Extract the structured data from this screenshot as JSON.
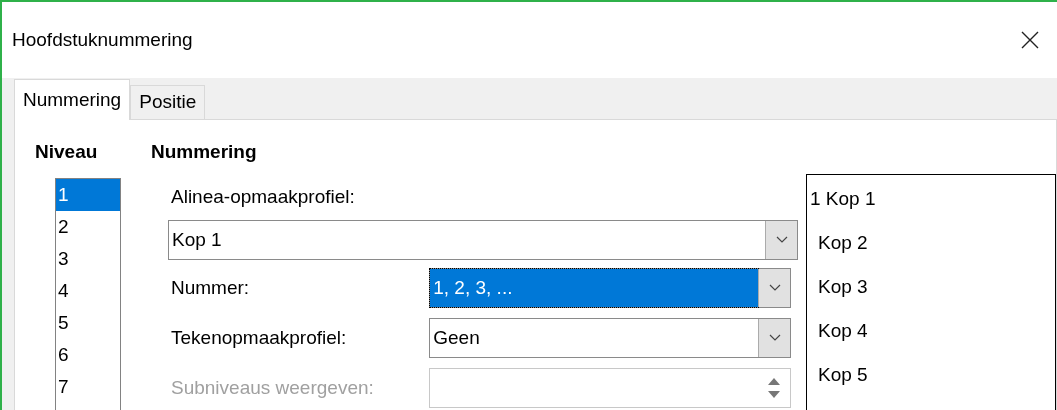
{
  "window": {
    "title": "Hoofdstuknummering"
  },
  "tabs": [
    {
      "label": "Nummering",
      "selected": true
    },
    {
      "label": "Positie",
      "selected": false
    }
  ],
  "level_list": {
    "heading": "Niveau",
    "items": [
      {
        "label": "1",
        "selected": true
      },
      {
        "label": "2",
        "selected": false
      },
      {
        "label": "3",
        "selected": false
      },
      {
        "label": "4",
        "selected": false
      },
      {
        "label": "5",
        "selected": false
      },
      {
        "label": "6",
        "selected": false
      },
      {
        "label": "7",
        "selected": false
      }
    ]
  },
  "numbering": {
    "heading": "Nummering",
    "paragraph_style": {
      "label": "Alinea-opmaakprofiel:",
      "value": "Kop 1"
    },
    "number": {
      "label": "Nummer:",
      "value": "1, 2, 3, ...",
      "selected": true
    },
    "character_style": {
      "label": "Tekenopmaakprofiel:",
      "value": "Geen",
      "selected": false
    },
    "show_sublevels": {
      "label": "Subniveaus weergeven:",
      "disabled": true
    }
  },
  "preview": [
    "1 Kop 1",
    "Kop 2",
    "Kop 3",
    "Kop 4",
    "Kop 5"
  ]
}
